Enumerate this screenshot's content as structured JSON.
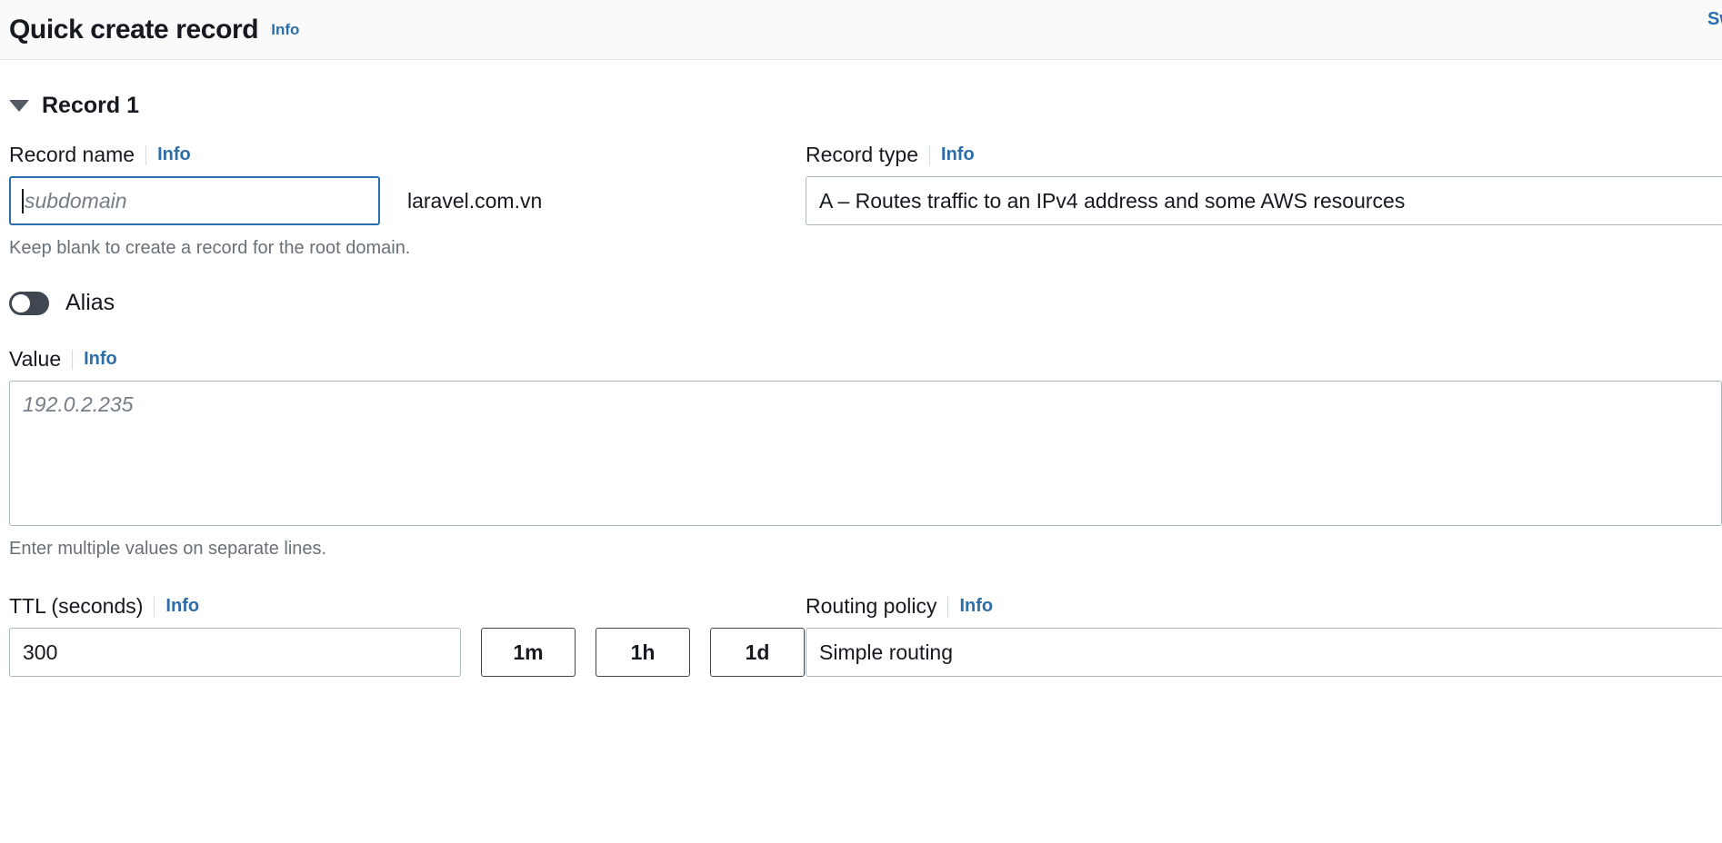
{
  "header": {
    "title": "Quick create record",
    "info_label": "Info",
    "action_label": "Switch to wizard"
  },
  "record": {
    "section_title": "Record 1",
    "caret_icon": "caret-down-icon",
    "record_name": {
      "label": "Record name",
      "info_label": "Info",
      "value": "",
      "placeholder": "subdomain",
      "domain_suffix": "laravel.com.vn",
      "hint": "Keep blank to create a record for the root domain."
    },
    "record_type": {
      "label": "Record type",
      "info_label": "Info",
      "selected": "A – Routes traffic to an IPv4 address and some AWS resources"
    },
    "alias": {
      "label": "Alias",
      "state": "off"
    },
    "value": {
      "label": "Value",
      "info_label": "Info",
      "value": "",
      "placeholder": "192.0.2.235",
      "hint": "Enter multiple values on separate lines."
    },
    "ttl": {
      "label": "TTL (seconds)",
      "info_label": "Info",
      "value": "300",
      "presets": [
        {
          "label": "1m"
        },
        {
          "label": "1h"
        },
        {
          "label": "1d"
        }
      ]
    },
    "routing_policy": {
      "label": "Routing policy",
      "info_label": "Info",
      "selected": "Simple routing"
    }
  },
  "colors": {
    "accent_link": "#2c6eaa",
    "focus_border": "#2c6eaa",
    "border": "#aab7b8",
    "text": "#16191f",
    "muted_text": "#687078",
    "header_bg": "#fafafa",
    "toggle_off": "#414750"
  }
}
